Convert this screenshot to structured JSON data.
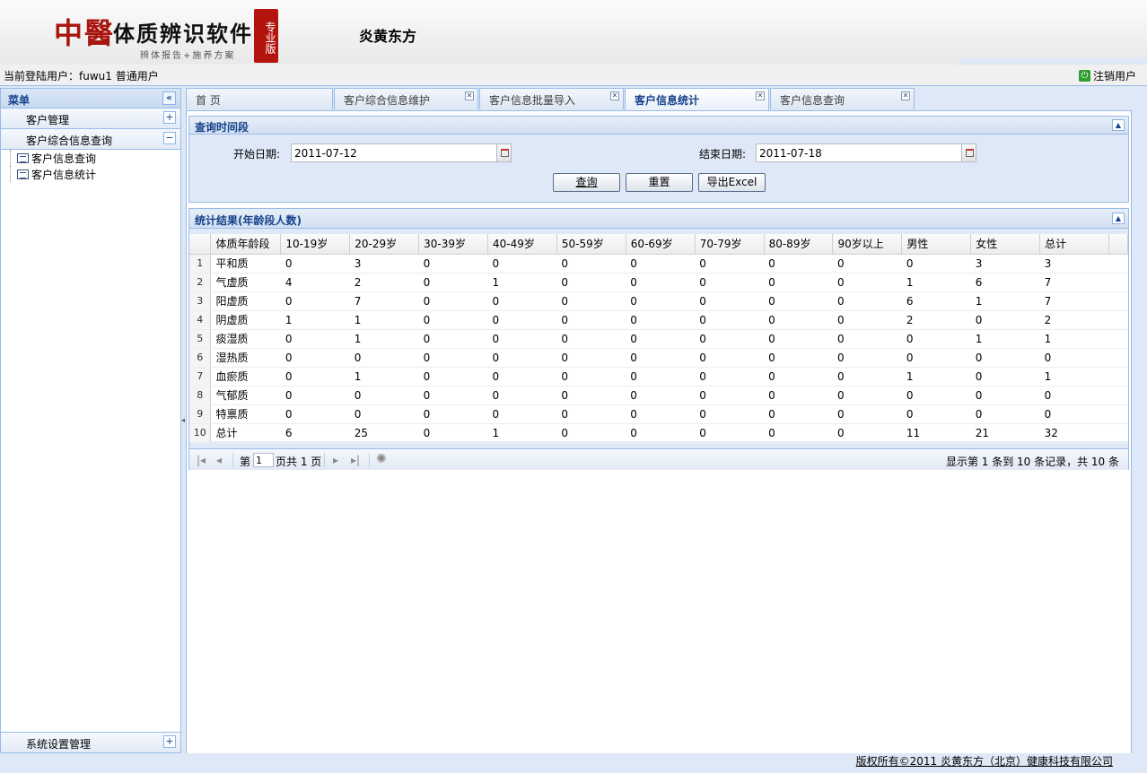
{
  "header": {
    "logo_mark": "中醫",
    "logo_title": "体质辨识软件",
    "logo_sub": "辨体报告+施养方案",
    "logo_seal": "专业版",
    "company": "炎黄东方"
  },
  "userbar": {
    "current_user": "当前登陆用户：fuwu1  普通用户",
    "logout": "注销用户"
  },
  "sidebar": {
    "title": "菜单",
    "sections": [
      {
        "label": "客户管理",
        "toggle": "+"
      },
      {
        "label": "客户综合信息查询",
        "toggle": "−"
      }
    ],
    "tree_items": [
      {
        "label": "客户信息查询"
      },
      {
        "label": "客户信息统计"
      }
    ],
    "bottom_section": {
      "label": "系统设置管理",
      "toggle": "+"
    }
  },
  "tabs": [
    {
      "label": "首 页",
      "closable": false
    },
    {
      "label": "客户综合信息维护",
      "closable": true
    },
    {
      "label": "客户信息批量导入",
      "closable": true
    },
    {
      "label": "客户信息统计",
      "closable": true,
      "active": true
    },
    {
      "label": "客户信息查询",
      "closable": true
    }
  ],
  "query": {
    "title": "查询时间段",
    "start_label": "开始日期:",
    "start_value": "2011-07-12",
    "end_label": "结束日期:",
    "end_value": "2011-07-18",
    "buttons": {
      "query": "查询",
      "reset": "重置",
      "export": "导出Excel"
    }
  },
  "results": {
    "title": "统计结果(年龄段人数)",
    "columns": [
      "体质年龄段",
      "10-19岁",
      "20-29岁",
      "30-39岁",
      "40-49岁",
      "50-59岁",
      "60-69岁",
      "70-79岁",
      "80-89岁",
      "90岁以上",
      "男性",
      "女性",
      "总计"
    ],
    "rows": [
      [
        "平和质",
        "0",
        "3",
        "0",
        "0",
        "0",
        "0",
        "0",
        "0",
        "0",
        "0",
        "3",
        "3"
      ],
      [
        "气虚质",
        "4",
        "2",
        "0",
        "1",
        "0",
        "0",
        "0",
        "0",
        "0",
        "1",
        "6",
        "7"
      ],
      [
        "阳虚质",
        "0",
        "7",
        "0",
        "0",
        "0",
        "0",
        "0",
        "0",
        "0",
        "6",
        "1",
        "7"
      ],
      [
        "阴虚质",
        "1",
        "1",
        "0",
        "0",
        "0",
        "0",
        "0",
        "0",
        "0",
        "2",
        "0",
        "2"
      ],
      [
        "痰湿质",
        "0",
        "1",
        "0",
        "0",
        "0",
        "0",
        "0",
        "0",
        "0",
        "0",
        "1",
        "1"
      ],
      [
        "湿热质",
        "0",
        "0",
        "0",
        "0",
        "0",
        "0",
        "0",
        "0",
        "0",
        "0",
        "0",
        "0"
      ],
      [
        "血瘀质",
        "0",
        "1",
        "0",
        "0",
        "0",
        "0",
        "0",
        "0",
        "0",
        "1",
        "0",
        "1"
      ],
      [
        "气郁质",
        "0",
        "0",
        "0",
        "0",
        "0",
        "0",
        "0",
        "0",
        "0",
        "0",
        "0",
        "0"
      ],
      [
        "特禀质",
        "0",
        "0",
        "0",
        "0",
        "0",
        "0",
        "0",
        "0",
        "0",
        "0",
        "0",
        "0"
      ],
      [
        "总计",
        "6",
        "25",
        "0",
        "1",
        "0",
        "0",
        "0",
        "0",
        "0",
        "11",
        "21",
        "32"
      ]
    ],
    "pager": {
      "page_prefix": "第",
      "page_value": "1",
      "page_suffix": "页共 1 页",
      "summary": "显示第 1 条到 10 条记录，共 10 条"
    }
  },
  "footer": {
    "copyright": "版权所有©2011 炎黄东方（北京）健康科技有限公司"
  }
}
